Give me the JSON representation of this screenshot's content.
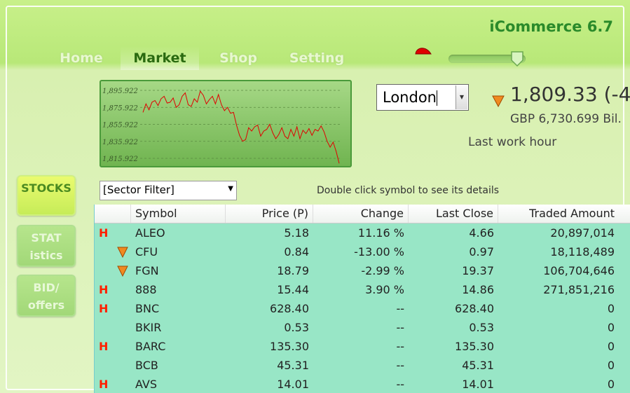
{
  "app": {
    "title": "iCommerce 6.7"
  },
  "nav": {
    "tabs": [
      {
        "label": "Home",
        "active": false
      },
      {
        "label": "Market",
        "active": true
      },
      {
        "label": "Shop",
        "active": false
      },
      {
        "label": "Setting",
        "active": false
      }
    ]
  },
  "slider": {
    "level": 0.9
  },
  "mini_chart": {
    "y_ticks": [
      "1,895.922",
      "1,875.922",
      "1,855.922",
      "1,835.922",
      "1,815.922"
    ],
    "y_values": [
      1895.922,
      1875.922,
      1855.922,
      1835.922,
      1815.922
    ],
    "series": [
      1870,
      1880,
      1873,
      1882,
      1884,
      1878,
      1886,
      1889,
      1881,
      1882,
      1887,
      1876,
      1879,
      1889,
      1893,
      1879,
      1877,
      1886,
      1882,
      1895,
      1890,
      1880,
      1885,
      1889,
      1880,
      1891,
      1879,
      1872,
      1876,
      1869,
      1870,
      1855,
      1843,
      1836,
      1838,
      1852,
      1848,
      1853,
      1855,
      1842,
      1848,
      1850,
      1856,
      1846,
      1839,
      1844,
      1852,
      1842,
      1839,
      1850,
      1842,
      1853,
      1839,
      1849,
      1845,
      1851,
      1843,
      1850,
      1848,
      1854,
      1847,
      1836,
      1829,
      1835,
      1824,
      1810
    ]
  },
  "market": {
    "city": "London",
    "index_value": "1,809.33  (-4",
    "index_direction": "down",
    "index_sub": "GBP 6,730.699 Bil.",
    "status": "Last work hour"
  },
  "side_buttons": [
    {
      "lines": [
        "STOCKS"
      ],
      "active": true,
      "icon": "stocks"
    },
    {
      "lines": [
        "STAT",
        "istics"
      ],
      "active": false,
      "icon": "statistics"
    },
    {
      "lines": [
        "BID/",
        "offers"
      ],
      "active": false,
      "icon": "bid-offers"
    }
  ],
  "filter": {
    "value": "[Sector Filter]",
    "hint": "Double click symbol to see its details"
  },
  "table": {
    "headers": [
      "",
      "Symbol",
      "Price (P)",
      "Change",
      "Last Close",
      "Traded Amount"
    ],
    "rows": [
      {
        "icon": "H",
        "symbol": "ALEO",
        "price": "5.18",
        "change": "11.16 %",
        "last_close": "4.66",
        "traded": "20,897,014"
      },
      {
        "icon": "down",
        "symbol": "CFU",
        "price": "0.84",
        "change": "-13.00 %",
        "last_close": "0.97",
        "traded": "18,118,489"
      },
      {
        "icon": "down",
        "symbol": "FGN",
        "price": "18.79",
        "change": "-2.99 %",
        "last_close": "19.37",
        "traded": "106,704,646"
      },
      {
        "icon": "H",
        "symbol": "888",
        "price": "15.44",
        "change": "3.90 %",
        "last_close": "14.86",
        "traded": "271,851,216"
      },
      {
        "icon": "H",
        "symbol": "BNC",
        "price": "628.40",
        "change": "--",
        "last_close": "628.40",
        "traded": "0"
      },
      {
        "icon": "",
        "symbol": "BKIR",
        "price": "0.53",
        "change": "--",
        "last_close": "0.53",
        "traded": "0"
      },
      {
        "icon": "H",
        "symbol": "BARC",
        "price": "135.30",
        "change": "--",
        "last_close": "135.30",
        "traded": "0"
      },
      {
        "icon": "",
        "symbol": "BCB",
        "price": "45.31",
        "change": "--",
        "last_close": "45.31",
        "traded": "0"
      },
      {
        "icon": "H",
        "symbol": "AVS",
        "price": "14.01",
        "change": "--",
        "last_close": "14.01",
        "traded": "0"
      }
    ]
  },
  "colors": {
    "accent": "#2a8a2a",
    "down": "#f08a20",
    "up": "#ff2000",
    "grid_bg": "#98e6c6"
  }
}
